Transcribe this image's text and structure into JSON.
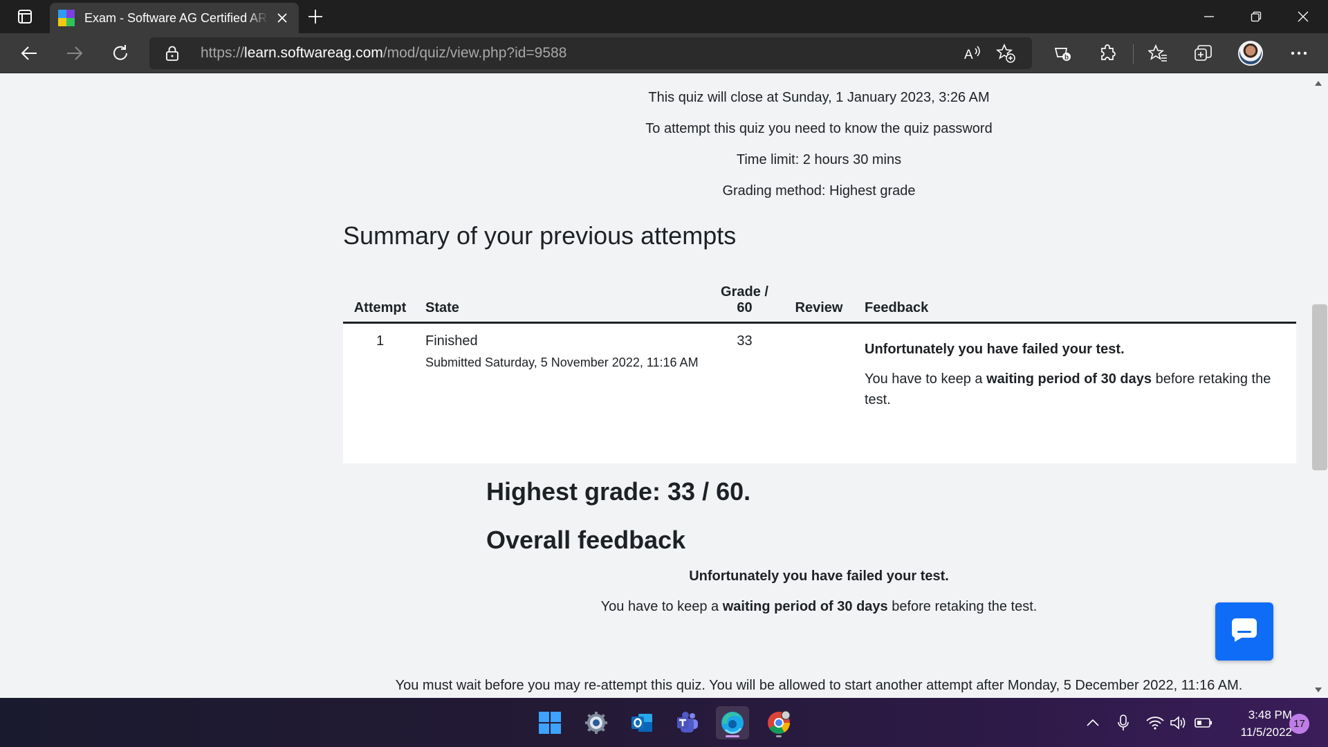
{
  "browser": {
    "tab": {
      "title": "Exam - Software AG Certified ARIS Professional",
      "favicon": "microsoft-squares-icon"
    },
    "url": {
      "scheme": "https://",
      "host": "learn.softwareag.com",
      "path": "/mod/quiz/view.php?id=9588"
    },
    "icons": [
      "tab-actions-icon",
      "close-icon",
      "plus-icon",
      "minimize-icon",
      "restore-icon",
      "back-arrow-icon",
      "forward-arrow-icon",
      "refresh-icon",
      "lock-icon",
      "read-aloud-icon",
      "add-favorite-icon",
      "shopping-icon",
      "extensions-icon",
      "favorites-icon",
      "collections-icon",
      "profile-avatar",
      "more-icon"
    ]
  },
  "quiz": {
    "info_lines": [
      "This quiz will close at Sunday, 1 January 2023, 3:26 AM",
      "To attempt this quiz you need to know the quiz password",
      "Time limit: 2 hours 30 mins",
      "Grading method: Highest grade"
    ],
    "summary_title": "Summary of your previous attempts",
    "table": {
      "headers": {
        "attempt": "Attempt",
        "state": "State",
        "grade_top": "Grade /",
        "grade_bottom": "60",
        "review": "Review",
        "feedback": "Feedback"
      },
      "rows": [
        {
          "attempt": "1",
          "state": "Finished",
          "submitted": "Submitted Saturday, 5 November 2022, 11:16 AM",
          "grade": "33",
          "review": "",
          "feedback_strong": "Unfortunately you have failed your test.",
          "feedback_pre": "You have to keep a ",
          "feedback_bold": "waiting period of 30 days",
          "feedback_post": " before retaking the test."
        }
      ]
    },
    "highest_grade": "Highest grade: 33 / 60.",
    "overall_title": "Overall feedback",
    "overall_strong": "Unfortunately you have failed your test.",
    "overall_pre": "You have to keep a ",
    "overall_bold": "waiting period of 30 days",
    "overall_post": " before retaking the test.",
    "wait_message": "You must wait before you may re-attempt this quiz. You will be allowed to start another attempt after Monday, 5 December 2022, 11:16 AM."
  },
  "chat": {
    "icon": "chat-bubble-icon",
    "color": "#0f6cf7"
  },
  "taskbar": {
    "apps": [
      "windows-start-icon",
      "settings-app-icon",
      "outlook-app-icon",
      "teams-app-icon",
      "edge-app-icon",
      "chrome-app-icon"
    ],
    "tray": [
      "chevron-up-icon",
      "microphone-icon",
      "wifi-icon",
      "volume-icon",
      "battery-icon"
    ],
    "time": "3:48 PM",
    "date": "11/5/2022",
    "notification_count": "17"
  }
}
